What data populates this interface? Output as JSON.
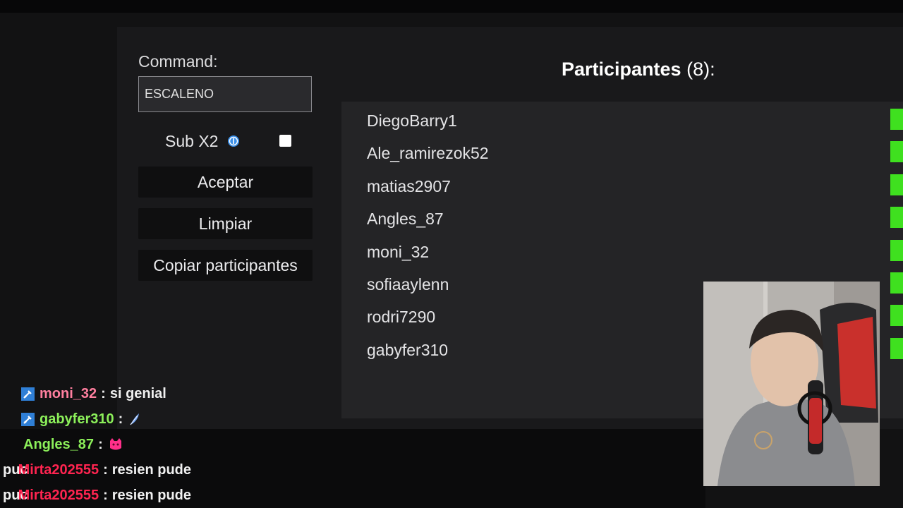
{
  "command": {
    "label": "Command:",
    "value": "ESCALENO"
  },
  "sub_option": {
    "label": "Sub X2",
    "checked": false
  },
  "buttons": {
    "accept": "Aceptar",
    "clear": "Limpiar",
    "copy": "Copiar participantes"
  },
  "participants": {
    "title": "Participantes",
    "count": "(8):",
    "items": [
      "DiegoBarry1",
      "Ale_ramirezok52",
      "matias2907",
      "Angles_87",
      "moni_32",
      "sofiaaylenn",
      "rodri7290",
      "gabyfer310"
    ]
  },
  "chat": [
    {
      "prefix": "",
      "user": "moni_32",
      "separator": ":",
      "message": "si genial",
      "user_color": "#ff7f9f",
      "badge": "sword-badge-icon"
    },
    {
      "prefix": "",
      "user": "gabyfer310",
      "separator": ":",
      "message": "",
      "user_color": "#8cf05a",
      "badge": "sword-badge-icon",
      "emote": "feather-emote-icon"
    },
    {
      "prefix": "",
      "user": "Angles_87",
      "separator": ":",
      "message": "",
      "user_color": "#8cf05a",
      "emote": "pink-cat-emote-icon"
    },
    {
      "prefix": "puc",
      "user": "Mirta202555",
      "separator": ":",
      "message": "resien pude",
      "user_color": "#ff2450"
    },
    {
      "prefix": "puc",
      "user": "Mirta202555",
      "separator": ":",
      "message": "resien pude",
      "user_color": "#ff2450"
    }
  ],
  "colors": {
    "accent_green": "#3fe01f",
    "info_blue": "#3a8fe8",
    "panel": "#19191b"
  }
}
